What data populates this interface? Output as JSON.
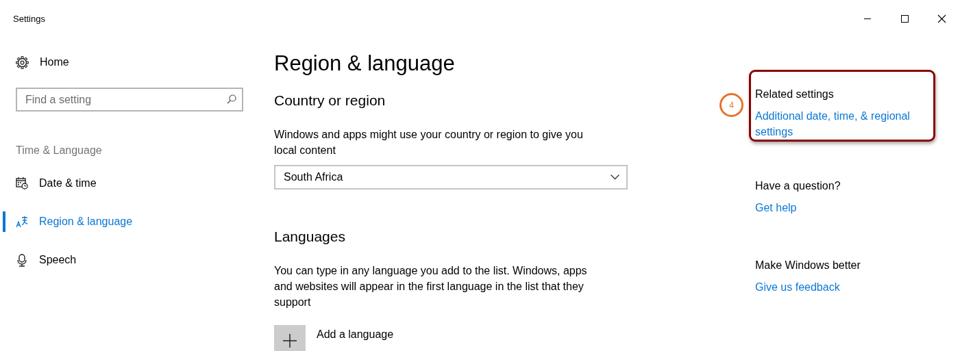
{
  "window": {
    "title": "Settings",
    "controls": [
      {
        "kind": "minimize"
      },
      {
        "kind": "maximize"
      },
      {
        "kind": "close"
      }
    ]
  },
  "sidebar": {
    "home": "Home",
    "search": {
      "placeholder": "Find a setting"
    },
    "section": "Time & Language",
    "items": [
      {
        "label": "Date & time",
        "kind": "calendar",
        "selected": false
      },
      {
        "label": "Region & language",
        "kind": "language",
        "selected": true
      },
      {
        "label": "Speech",
        "kind": "microphone",
        "selected": false
      }
    ]
  },
  "main": {
    "title": "Region & language",
    "sections": [
      {
        "heading": "Country or region",
        "description": "Windows and apps might use your country or region to give you local content",
        "dropdown": {
          "value": "South Africa"
        }
      },
      {
        "heading": "Languages",
        "description": "You can type in any language you add to the list. Windows, apps and websites will appear in the first language in the list that they support",
        "add_button": "Add a language"
      }
    ]
  },
  "related": [
    {
      "heading": "Related settings",
      "links": [
        "Additional date, time, & regional settings"
      ],
      "highlighted": true,
      "callout": "4"
    },
    {
      "heading": "Have a question?",
      "links": [
        "Get help"
      ],
      "highlighted": false
    },
    {
      "heading": "Make Windows better",
      "links": [
        "Give us feedback"
      ],
      "highlighted": false
    }
  ]
}
